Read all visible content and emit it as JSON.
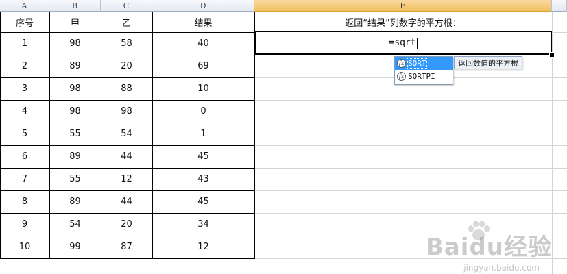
{
  "column_headers": [
    "A",
    "B",
    "C",
    "D",
    "E"
  ],
  "table": {
    "headers": [
      "序号",
      "甲",
      "乙",
      "结果"
    ],
    "rows": [
      [
        "1",
        "98",
        "58",
        "40"
      ],
      [
        "2",
        "89",
        "20",
        "69"
      ],
      [
        "3",
        "98",
        "88",
        "10"
      ],
      [
        "4",
        "98",
        "98",
        "0"
      ],
      [
        "5",
        "55",
        "54",
        "1"
      ],
      [
        "6",
        "89",
        "44",
        "45"
      ],
      [
        "7",
        "55",
        "12",
        "43"
      ],
      [
        "8",
        "89",
        "44",
        "45"
      ],
      [
        "9",
        "54",
        "20",
        "34"
      ],
      [
        "10",
        "99",
        "87",
        "12"
      ]
    ]
  },
  "note": "返回“结果”列数字的平方根：",
  "formula_text": "=sqrt",
  "autocomplete": {
    "items": [
      "SQRT",
      "SQRTPI"
    ],
    "selected_index": 0,
    "tooltip": "返回数值的平方根"
  },
  "watermark": {
    "logo": "Baidu经验",
    "url": "jingyan.baidu.com"
  },
  "colors": {
    "active_column_header": "#f1c15f",
    "autocomplete_selected": "#3399ff"
  }
}
